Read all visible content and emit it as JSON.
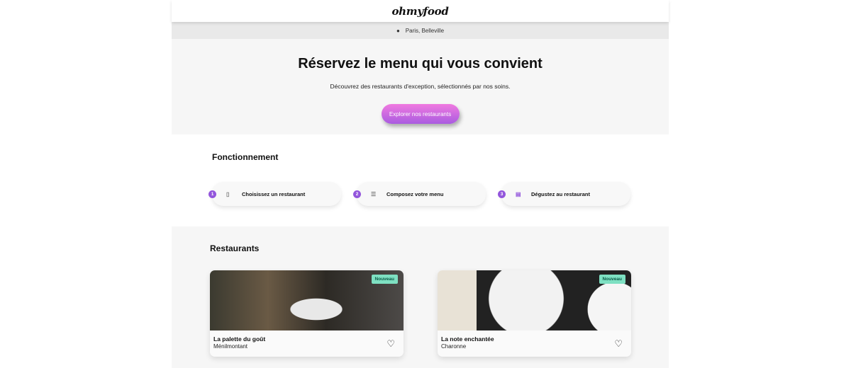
{
  "header": {
    "logo": "ohmyfood",
    "location": "Paris, Belleville"
  },
  "hero": {
    "title": "Réservez le menu qui vous convient",
    "subtitle": "Découvrez des restaurants d'exception, sélectionnés par nos soins.",
    "cta": "Explorer nos restaurants"
  },
  "how": {
    "title": "Fonctionnement",
    "steps": [
      {
        "num": "1",
        "label": "Choisissez un restaurant",
        "icon": "phone-icon"
      },
      {
        "num": "2",
        "label": "Composez votre menu",
        "icon": "list-icon"
      },
      {
        "num": "3",
        "label": "Dégustez au restaurant",
        "icon": "store-icon"
      }
    ]
  },
  "restaurants": {
    "title": "Restaurants",
    "cards": [
      {
        "name": "La palette du goût",
        "area": "Ménilmontant",
        "badge": "Nouveau"
      },
      {
        "name": "La note enchantée",
        "area": "Charonne",
        "badge": "Nouveau"
      }
    ]
  },
  "colors": {
    "accent": "#9356dc",
    "badge": "#7ee0c2"
  }
}
